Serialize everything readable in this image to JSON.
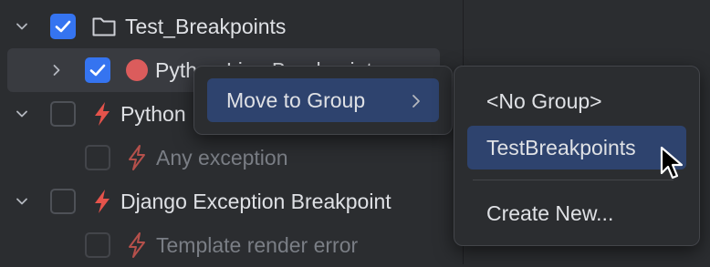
{
  "tree": {
    "rows": [
      {
        "label": "Test_Breakpoints"
      },
      {
        "label": "Python Line Breakpoint"
      },
      {
        "label": "Python"
      },
      {
        "label": "Any exception"
      },
      {
        "label": "Django Exception Breakpoint"
      },
      {
        "label": "Template render error"
      }
    ]
  },
  "context_menu": {
    "move_to_group": "Move to Group"
  },
  "submenu": {
    "no_group": "<No Group>",
    "test_breakpoints": "TestBreakpoints",
    "create_new": "Create New..."
  },
  "colors": {
    "accent": "#3574f0",
    "breakpoint_red": "#db5c5c",
    "exception_red": "#e5534b",
    "menu_highlight": "#2e436e"
  }
}
